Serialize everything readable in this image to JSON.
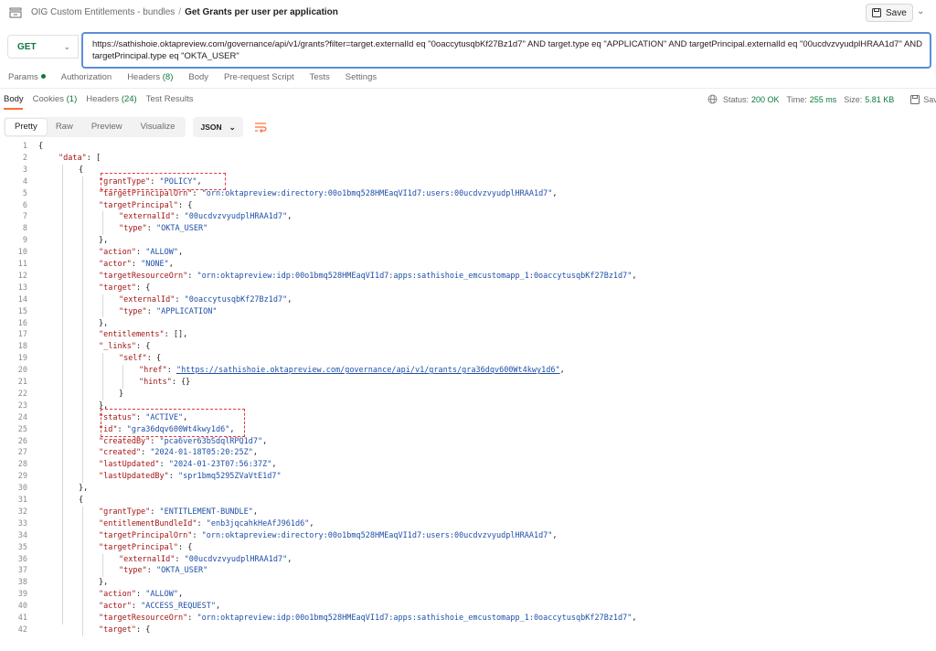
{
  "breadcrumb": {
    "collection": "OIG Custom Entitlements - bundles",
    "separator": "/",
    "request": "Get Grants per user per application"
  },
  "save_button": {
    "label": "Save"
  },
  "request": {
    "method": "GET",
    "url_line1": "https://sathishoie.oktapreview.com/governance/api/v1/grants?filter=target.externalId eq \"0oaccytusqbKf27Bz1d7\" AND target.type eq \"APPLICATION\" AND targetPrincipal.externalId eq \"00ucdvzvyudplHRAA1d7\" AND",
    "url_line2": "targetPrincipal.type eq \"OKTA_USER\""
  },
  "request_tabs": [
    {
      "label": "Params",
      "count": ""
    },
    {
      "label": "Authorization",
      "count": ""
    },
    {
      "label": "Headers",
      "count": "(8)"
    },
    {
      "label": "Body",
      "count": ""
    },
    {
      "label": "Pre-request Script",
      "count": ""
    },
    {
      "label": "Tests",
      "count": ""
    },
    {
      "label": "Settings",
      "count": ""
    }
  ],
  "response_tabs": [
    {
      "label": "Body",
      "count": ""
    },
    {
      "label": "Cookies",
      "count": "(1)"
    },
    {
      "label": "Headers",
      "count": "(24)"
    },
    {
      "label": "Test Results",
      "count": ""
    }
  ],
  "response_status": {
    "status_label": "Status:",
    "status_value": "200 OK",
    "time_label": "Time:",
    "time_value": "255 ms",
    "size_label": "Size:",
    "size_value": "5.81 KB",
    "save_label": "Save"
  },
  "view_modes": [
    "Pretty",
    "Raw",
    "Preview",
    "Visualize"
  ],
  "format_select": "JSON",
  "colors": {
    "accent": "#ff6c37",
    "success": "#0c7a3e",
    "key": "#a31515",
    "string": "#1f4fa8",
    "highlight": "#e03a3a"
  },
  "code_lines": [
    [
      [
        "p",
        "{"
      ]
    ],
    [
      [
        "k",
        "\"data\""
      ],
      [
        "p",
        ": ["
      ]
    ],
    [
      [
        "p",
        "{"
      ]
    ],
    [
      [
        "k",
        "\"grantType\""
      ],
      [
        "p",
        ": "
      ],
      [
        "s",
        "\"POLICY\""
      ],
      [
        "p",
        ","
      ]
    ],
    [
      [
        "k",
        "\"targetPrincipalOrn\""
      ],
      [
        "p",
        ": "
      ],
      [
        "s",
        "\"orn:oktapreview:directory:00o1bmq528HMEaqVI1d7:users:00ucdvzvyudplHRAA1d7\""
      ],
      [
        "p",
        ","
      ]
    ],
    [
      [
        "k",
        "\"targetPrincipal\""
      ],
      [
        "p",
        ": {"
      ]
    ],
    [
      [
        "k",
        "\"externalId\""
      ],
      [
        "p",
        ": "
      ],
      [
        "s",
        "\"00ucdvzvyudplHRAA1d7\""
      ],
      [
        "p",
        ","
      ]
    ],
    [
      [
        "k",
        "\"type\""
      ],
      [
        "p",
        ": "
      ],
      [
        "s",
        "\"OKTA_USER\""
      ]
    ],
    [
      [
        "p",
        "},"
      ]
    ],
    [
      [
        "k",
        "\"action\""
      ],
      [
        "p",
        ": "
      ],
      [
        "s",
        "\"ALLOW\""
      ],
      [
        "p",
        ","
      ]
    ],
    [
      [
        "k",
        "\"actor\""
      ],
      [
        "p",
        ": "
      ],
      [
        "s",
        "\"NONE\""
      ],
      [
        "p",
        ","
      ]
    ],
    [
      [
        "k",
        "\"targetResourceOrn\""
      ],
      [
        "p",
        ": "
      ],
      [
        "s",
        "\"orn:oktapreview:idp:00o1bmq528HMEaqVI1d7:apps:sathishoie_emcustomapp_1:0oaccytusqbKf27Bz1d7\""
      ],
      [
        "p",
        ","
      ]
    ],
    [
      [
        "k",
        "\"target\""
      ],
      [
        "p",
        ": {"
      ]
    ],
    [
      [
        "k",
        "\"externalId\""
      ],
      [
        "p",
        ": "
      ],
      [
        "s",
        "\"0oaccytusqbKf27Bz1d7\""
      ],
      [
        "p",
        ","
      ]
    ],
    [
      [
        "k",
        "\"type\""
      ],
      [
        "p",
        ": "
      ],
      [
        "s",
        "\"APPLICATION\""
      ]
    ],
    [
      [
        "p",
        "},"
      ]
    ],
    [
      [
        "k",
        "\"entitlements\""
      ],
      [
        "p",
        ": [],"
      ]
    ],
    [
      [
        "k",
        "\"_links\""
      ],
      [
        "p",
        ": {"
      ]
    ],
    [
      [
        "k",
        "\"self\""
      ],
      [
        "p",
        ": {"
      ]
    ],
    [
      [
        "k",
        "\"href\""
      ],
      [
        "p",
        ": "
      ],
      [
        "u",
        "\"https://sathishoie.oktapreview.com/governance/api/v1/grants/gra36dqv600Wt4kwy1d6\""
      ],
      [
        "p",
        ","
      ]
    ],
    [
      [
        "k",
        "\"hints\""
      ],
      [
        "p",
        ": {}"
      ]
    ],
    [
      [
        "p",
        "}"
      ]
    ],
    [
      [
        "p",
        "},"
      ]
    ],
    [
      [
        "k",
        "\"status\""
      ],
      [
        "p",
        ": "
      ],
      [
        "s",
        "\"ACTIVE\""
      ],
      [
        "p",
        ","
      ]
    ],
    [
      [
        "k",
        "\"id\""
      ],
      [
        "p",
        ": "
      ],
      [
        "s",
        "\"gra36dqv600Wt4kwy1d6\""
      ],
      [
        "p",
        ","
      ]
    ],
    [
      [
        "k",
        "\"createdBy\""
      ],
      [
        "p",
        ": "
      ],
      [
        "s",
        "\"pca6ver63bSdqlRPQ1d7\""
      ],
      [
        "p",
        ","
      ]
    ],
    [
      [
        "k",
        "\"created\""
      ],
      [
        "p",
        ": "
      ],
      [
        "s",
        "\"2024-01-18T05:20:25Z\""
      ],
      [
        "p",
        ","
      ]
    ],
    [
      [
        "k",
        "\"lastUpdated\""
      ],
      [
        "p",
        ": "
      ],
      [
        "s",
        "\"2024-01-23T07:56:37Z\""
      ],
      [
        "p",
        ","
      ]
    ],
    [
      [
        "k",
        "\"lastUpdatedBy\""
      ],
      [
        "p",
        ": "
      ],
      [
        "s",
        "\"spr1bmq5295ZVaVtE1d7\""
      ]
    ],
    [
      [
        "p",
        "},"
      ]
    ],
    [
      [
        "p",
        "{"
      ]
    ],
    [
      [
        "k",
        "\"grantType\""
      ],
      [
        "p",
        ": "
      ],
      [
        "s",
        "\"ENTITLEMENT-BUNDLE\""
      ],
      [
        "p",
        ","
      ]
    ],
    [
      [
        "k",
        "\"entitlementBundleId\""
      ],
      [
        "p",
        ": "
      ],
      [
        "s",
        "\"enb3jqcahkHeAfJ961d6\""
      ],
      [
        "p",
        ","
      ]
    ],
    [
      [
        "k",
        "\"targetPrincipalOrn\""
      ],
      [
        "p",
        ": "
      ],
      [
        "s",
        "\"orn:oktapreview:directory:00o1bmq528HMEaqVI1d7:users:00ucdvzvyudplHRAA1d7\""
      ],
      [
        "p",
        ","
      ]
    ],
    [
      [
        "k",
        "\"targetPrincipal\""
      ],
      [
        "p",
        ": {"
      ]
    ],
    [
      [
        "k",
        "\"externalId\""
      ],
      [
        "p",
        ": "
      ],
      [
        "s",
        "\"00ucdvzvyudplHRAA1d7\""
      ],
      [
        "p",
        ","
      ]
    ],
    [
      [
        "k",
        "\"type\""
      ],
      [
        "p",
        ": "
      ],
      [
        "s",
        "\"OKTA_USER\""
      ]
    ],
    [
      [
        "p",
        "},"
      ]
    ],
    [
      [
        "k",
        "\"action\""
      ],
      [
        "p",
        ": "
      ],
      [
        "s",
        "\"ALLOW\""
      ],
      [
        "p",
        ","
      ]
    ],
    [
      [
        "k",
        "\"actor\""
      ],
      [
        "p",
        ": "
      ],
      [
        "s",
        "\"ACCESS_REQUEST\""
      ],
      [
        "p",
        ","
      ]
    ],
    [
      [
        "k",
        "\"targetResourceOrn\""
      ],
      [
        "p",
        ": "
      ],
      [
        "s",
        "\"orn:oktapreview:idp:00o1bmq528HMEaqVI1d7:apps:sathishoie_emcustomapp_1:0oaccytusqbKf27Bz1d7\""
      ],
      [
        "p",
        ","
      ]
    ],
    [
      [
        "k",
        "\"target\""
      ],
      [
        "p",
        ": {"
      ]
    ]
  ]
}
